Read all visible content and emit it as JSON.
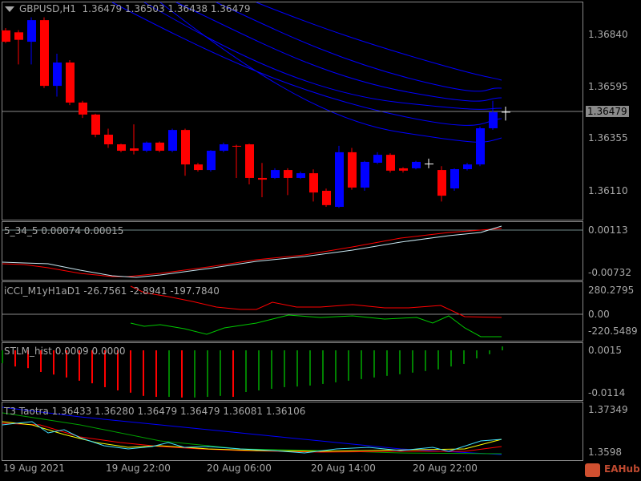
{
  "main": {
    "symbol": "GBPUSD,H1",
    "ohlc": "1.36479 1.36503 1.36438 1.36479",
    "price_labels": [
      "1.36840",
      "1.36595",
      "1.36355",
      "1.36110"
    ],
    "current_price": "1.36479",
    "candles": [
      [
        1.36859,
        1.36806,
        1.3687,
        1.368
      ],
      [
        1.3685,
        1.36815,
        1.3686,
        1.367
      ],
      [
        1.36806,
        1.36907,
        1.3692,
        1.367
      ],
      [
        1.36907,
        1.366,
        1.3692,
        1.3659
      ],
      [
        1.366,
        1.36709,
        1.3675,
        1.3655
      ],
      [
        1.36709,
        1.36522,
        1.3672,
        1.3651
      ],
      [
        1.36522,
        1.36466,
        1.3653,
        1.3645
      ],
      [
        1.36466,
        1.36372,
        1.3647,
        1.3636
      ],
      [
        1.36372,
        1.36327,
        1.364,
        1.3631
      ],
      [
        1.36327,
        1.36297,
        1.3633,
        1.3629
      ],
      [
        1.36308,
        1.36297,
        1.3642,
        1.3628
      ],
      [
        1.36297,
        1.36335,
        1.3634,
        1.3629
      ],
      [
        1.36335,
        1.36297,
        1.3634,
        1.3629
      ],
      [
        1.36297,
        1.36394,
        1.364,
        1.3629
      ],
      [
        1.36394,
        1.36233,
        1.364,
        1.3618
      ],
      [
        1.36233,
        1.36207,
        1.3624,
        1.362
      ],
      [
        1.36207,
        1.36297,
        1.363,
        1.362
      ],
      [
        1.36297,
        1.36327,
        1.36335,
        1.3629
      ],
      [
        1.3632,
        1.36316,
        1.36325,
        1.3617
      ],
      [
        1.36327,
        1.3617,
        1.3633,
        1.3614
      ],
      [
        1.3617,
        1.36162,
        1.3624,
        1.3608
      ],
      [
        1.3617,
        1.36207,
        1.36215,
        1.36165
      ],
      [
        1.36207,
        1.3617,
        1.36215,
        1.3609
      ],
      [
        1.3617,
        1.36192,
        1.362,
        1.36165
      ],
      [
        1.36192,
        1.36102,
        1.3621,
        1.3606
      ],
      [
        1.3611,
        1.36043,
        1.3612,
        1.36035
      ],
      [
        1.36035,
        1.3629,
        1.3632,
        1.3603
      ],
      [
        1.3629,
        1.36125,
        1.3631,
        1.36115
      ],
      [
        1.36125,
        1.36245,
        1.3625,
        1.3611
      ],
      [
        1.36241,
        1.36278,
        1.3629,
        1.36235
      ],
      [
        1.36278,
        1.36204,
        1.36285,
        1.36195
      ],
      [
        1.36215,
        1.36204,
        1.3622,
        1.36195
      ],
      [
        1.36215,
        1.36245,
        1.3625,
        1.3621
      ],
      [
        1.36237,
        1.36237,
        1.3626,
        1.36215
      ],
      [
        1.36207,
        1.36087,
        1.36225,
        1.3606
      ],
      [
        1.36121,
        1.36211,
        1.36215,
        1.3611
      ],
      [
        1.36211,
        1.36233,
        1.3624,
        1.36205
      ],
      [
        1.36233,
        1.36402,
        1.3641,
        1.36225
      ],
      [
        1.36402,
        1.36477,
        1.3653,
        1.36395
      ],
      [
        1.36479,
        1.36479,
        1.36503,
        1.36438
      ]
    ]
  },
  "ao": {
    "label": "5_34_5 0.00074 0.00015",
    "max": "0.00113",
    "min": "-0.00732"
  },
  "cci": {
    "label": "iCCI_M1yH1aD1 -26.7561 -2.8941 -197.7840",
    "max": "280.2795",
    "zero": "0.00",
    "min": "-220.5489"
  },
  "stlm": {
    "label": "STLM_hist 0.0009 0.0000",
    "max": "0.0015",
    "min": "-0.0114",
    "values": [
      -0.004,
      -0.005,
      -0.0055,
      -0.0067,
      -0.0075,
      -0.0084,
      -0.0094,
      -0.0102,
      -0.0114,
      -0.0124,
      -0.0131,
      -0.0141,
      -0.0144,
      -0.0144,
      -0.0146,
      -0.0146,
      -0.0144,
      -0.0141,
      -0.0144,
      -0.0129,
      -0.0124,
      -0.0119,
      -0.0114,
      -0.0112,
      -0.0109,
      -0.0104,
      -0.0099,
      -0.0094,
      -0.0089,
      -0.0084,
      -0.0079,
      -0.0074,
      -0.0069,
      -0.0064,
      -0.0059,
      -0.005,
      -0.0042,
      -0.0025,
      -0.0012,
      0.0012
    ],
    "up_color": "#008000",
    "down_color": "#ff0000"
  },
  "t3": {
    "label": "T3 Taotra 1.36433 1.36280 1.36479 1.36479 1.36081 1.36106",
    "max": "1.37349",
    "min": "1.3598"
  },
  "time_labels": [
    "19 Aug 2021",
    "19 Aug 22:00",
    "20 Aug 06:00",
    "20 Aug 14:00",
    "20 Aug 22:00"
  ],
  "brand": "EAHub",
  "colors": {
    "bull": "#0000ff",
    "bear": "#ff0000"
  }
}
